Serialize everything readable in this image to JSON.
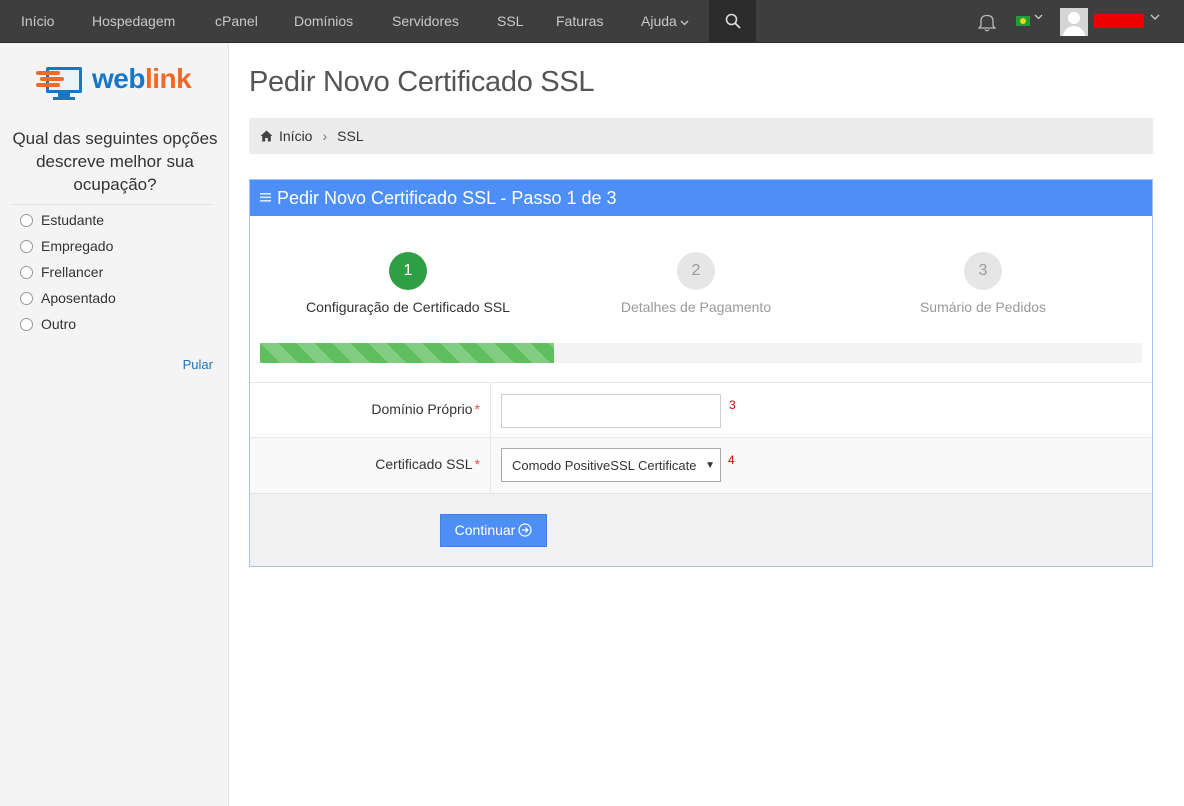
{
  "nav": {
    "items": [
      "Início",
      "Hospedagem",
      "cPanel",
      "Domínios",
      "Servidores",
      "SSL",
      "Faturas",
      "Ajuda"
    ]
  },
  "sidebar": {
    "logo_text_a": "web",
    "logo_text_b": "link",
    "survey_question": "Qual das seguintes opções descreve melhor sua ocupação?",
    "options": [
      "Estudante",
      "Empregado",
      "Frellancer",
      "Aposentado",
      "Outro"
    ],
    "skip_label": "Pular"
  },
  "page": {
    "title": "Pedir Novo Certificado SSL"
  },
  "breadcrumb": {
    "home": "Início",
    "current": "SSL"
  },
  "panel": {
    "heading": "Pedir Novo Certificado SSL - Passo 1 de 3",
    "steps": [
      {
        "number": "1",
        "label": "Configuração de Certificado SSL"
      },
      {
        "number": "2",
        "label": "Detalhes de Pagamento"
      },
      {
        "number": "3",
        "label": "Sumário de Pedidos"
      }
    ],
    "progress_fraction": 0.333
  },
  "form": {
    "domain_label": "Domínio Próprio",
    "domain_value": "",
    "domain_annotation": "3",
    "cert_label": "Certificado SSL",
    "cert_selected": "Comodo PositiveSSL Certificate",
    "cert_annotation": "4",
    "required_mark": "*",
    "continue_label": "Continuar"
  },
  "colors": {
    "accent": "#4d8ff7",
    "step_active": "#2f9f44",
    "progress": "#5fbf5f",
    "nav_bg": "#3e3e3e"
  }
}
